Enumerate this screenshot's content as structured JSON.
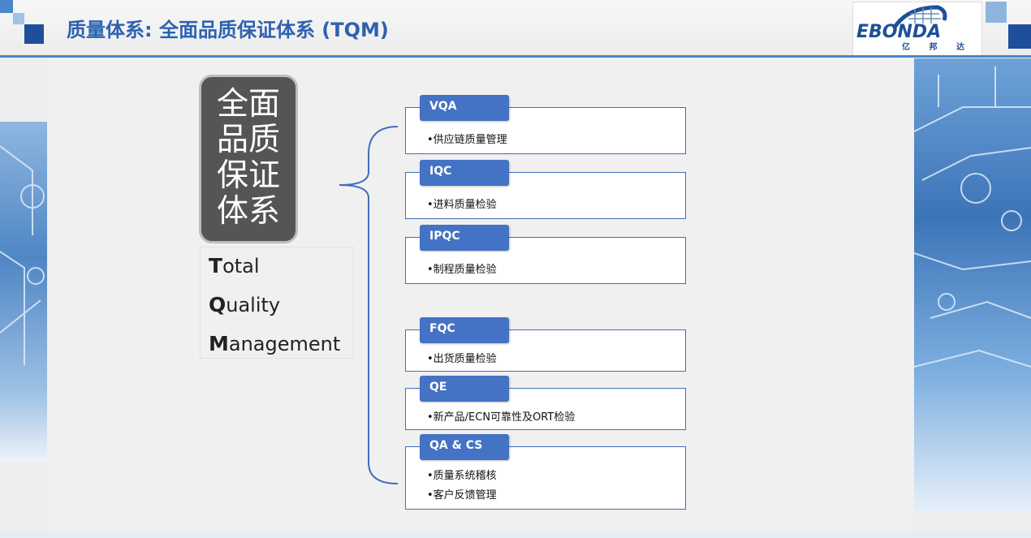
{
  "header": {
    "title": "质量体系: 全面品质保证体系 (TQM)",
    "logo": {
      "name": "EBONDA",
      "subtitle": "亿 邦 达"
    },
    "accent_color": "#2e62b0",
    "rule_color": "#4a86c8"
  },
  "left": {
    "box_lines": [
      "全面",
      "品质",
      "保证",
      "体系"
    ],
    "tqm": [
      {
        "initial": "T",
        "rest": "otal"
      },
      {
        "initial": "Q",
        "rest": "uality"
      },
      {
        "initial": "M",
        "rest": "anagement"
      }
    ]
  },
  "items": [
    {
      "tag": "VQA",
      "lines": [
        "•供应链质量管理"
      ]
    },
    {
      "tag": "IQC",
      "lines": [
        "•进料质量检验"
      ]
    },
    {
      "tag": "IPQC",
      "lines": [
        "•制程质量检验"
      ]
    },
    {
      "tag": "FQC",
      "lines": [
        "•出货质量检验"
      ]
    },
    {
      "tag": "QE",
      "lines": [
        "•新产品/ECN可靠性及ORT检验"
      ]
    },
    {
      "tag": "QA & CS",
      "lines": [
        "•质量系统稽核",
        "•客户反馈管理"
      ]
    }
  ],
  "colors": {
    "tab": "#4472c4",
    "box_border": "#3f6fb8",
    "dark_box": "#555555"
  }
}
